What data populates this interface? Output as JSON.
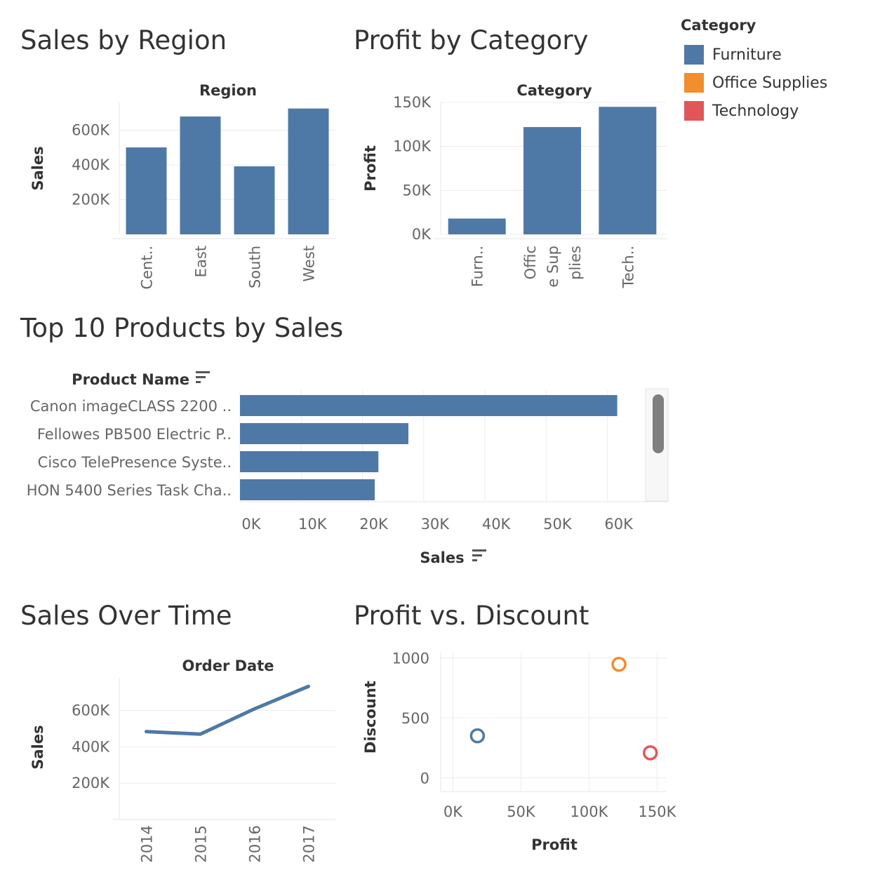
{
  "titles": {
    "sales_by_region": "Sales by Region",
    "profit_by_category": "Profit by Category",
    "top10": "Top 10 Products by Sales",
    "sales_over_time": "Sales Over Time",
    "profit_vs_discount": "Profit vs. Discount"
  },
  "legend": {
    "title": "Category",
    "items": [
      {
        "label": "Furniture",
        "color": "#4e79a7"
      },
      {
        "label": "Office Supplies",
        "color": "#f28e2b"
      },
      {
        "label": "Technology",
        "color": "#e15759"
      }
    ]
  },
  "chart_data": [
    {
      "id": "sales_by_region",
      "type": "bar",
      "title": "Sales by Region",
      "column_header": "Region",
      "ylabel": "Sales",
      "categories": [
        "Central",
        "East",
        "South",
        "West"
      ],
      "category_labels": [
        "Cent..",
        "East",
        "South",
        "West"
      ],
      "values": [
        501000,
        679000,
        392000,
        725000
      ],
      "ylim": [
        0,
        760000
      ],
      "yticks": [
        200000,
        400000,
        600000
      ],
      "ytick_labels": [
        "200K",
        "400K",
        "600K"
      ],
      "color": "#4e79a7",
      "grid": true
    },
    {
      "id": "profit_by_category",
      "type": "bar",
      "title": "Profit by Category",
      "column_header": "Category",
      "ylabel": "Profit",
      "categories": [
        "Furniture",
        "Office Supplies",
        "Technology"
      ],
      "category_labels": [
        [
          "Furn.."
        ],
        [
          "Offic",
          "e Sup",
          "plies"
        ],
        [
          "Tech.."
        ]
      ],
      "values": [
        18000,
        122000,
        145000
      ],
      "ylim": [
        0,
        150000
      ],
      "yticks": [
        0,
        50000,
        100000,
        150000
      ],
      "ytick_labels": [
        "0K",
        "50K",
        "100K",
        "150K"
      ],
      "color": "#4e79a7",
      "grid": true
    },
    {
      "id": "top10_products",
      "type": "bar",
      "orientation": "horizontal",
      "title": "Top 10 Products by Sales",
      "row_header": "Product Name",
      "xlabel": "Sales",
      "categories": [
        "Canon imageCLASS 2200 ..",
        "Fellowes PB500 Electric P..",
        "Cisco TelePresence Syste..",
        "HON 5400 Series Task Cha.."
      ],
      "values": [
        61600,
        27500,
        22600,
        22000
      ],
      "xlim": [
        0,
        66000
      ],
      "xticks": [
        0,
        10000,
        20000,
        30000,
        40000,
        50000,
        60000
      ],
      "xtick_labels": [
        "0K",
        "10K",
        "20K",
        "30K",
        "40K",
        "50K",
        "60K"
      ],
      "color": "#4e79a7",
      "grid": true
    },
    {
      "id": "sales_over_time",
      "type": "line",
      "title": "Sales Over Time",
      "column_header": "Order Date",
      "ylabel": "Sales",
      "x": [
        "2014",
        "2015",
        "2016",
        "2017"
      ],
      "values": [
        484000,
        470000,
        609000,
        733000
      ],
      "ylim": [
        0,
        780000
      ],
      "yticks": [
        200000,
        400000,
        600000
      ],
      "ytick_labels": [
        "200K",
        "400K",
        "600K"
      ],
      "color": "#4e79a7",
      "grid": true
    },
    {
      "id": "profit_vs_discount",
      "type": "scatter",
      "title": "Profit vs. Discount",
      "xlabel": "Profit",
      "ylabel": "Discount",
      "points": [
        {
          "category": "Furniture",
          "x": 18000,
          "y": 350,
          "color": "#4e79a7"
        },
        {
          "category": "Office Supplies",
          "x": 122000,
          "y": 947,
          "color": "#f28e2b"
        },
        {
          "category": "Technology",
          "x": 145000,
          "y": 208,
          "color": "#e15759"
        }
      ],
      "xlim": [
        -9000,
        157000
      ],
      "ylim": [
        -115,
        1045
      ],
      "xticks": [
        0,
        50000,
        100000,
        150000
      ],
      "xtick_labels": [
        "0K",
        "50K",
        "100K",
        "150K"
      ],
      "yticks": [
        0,
        500,
        1000
      ],
      "ytick_labels": [
        "0",
        "500",
        "1000"
      ],
      "grid": true
    }
  ]
}
